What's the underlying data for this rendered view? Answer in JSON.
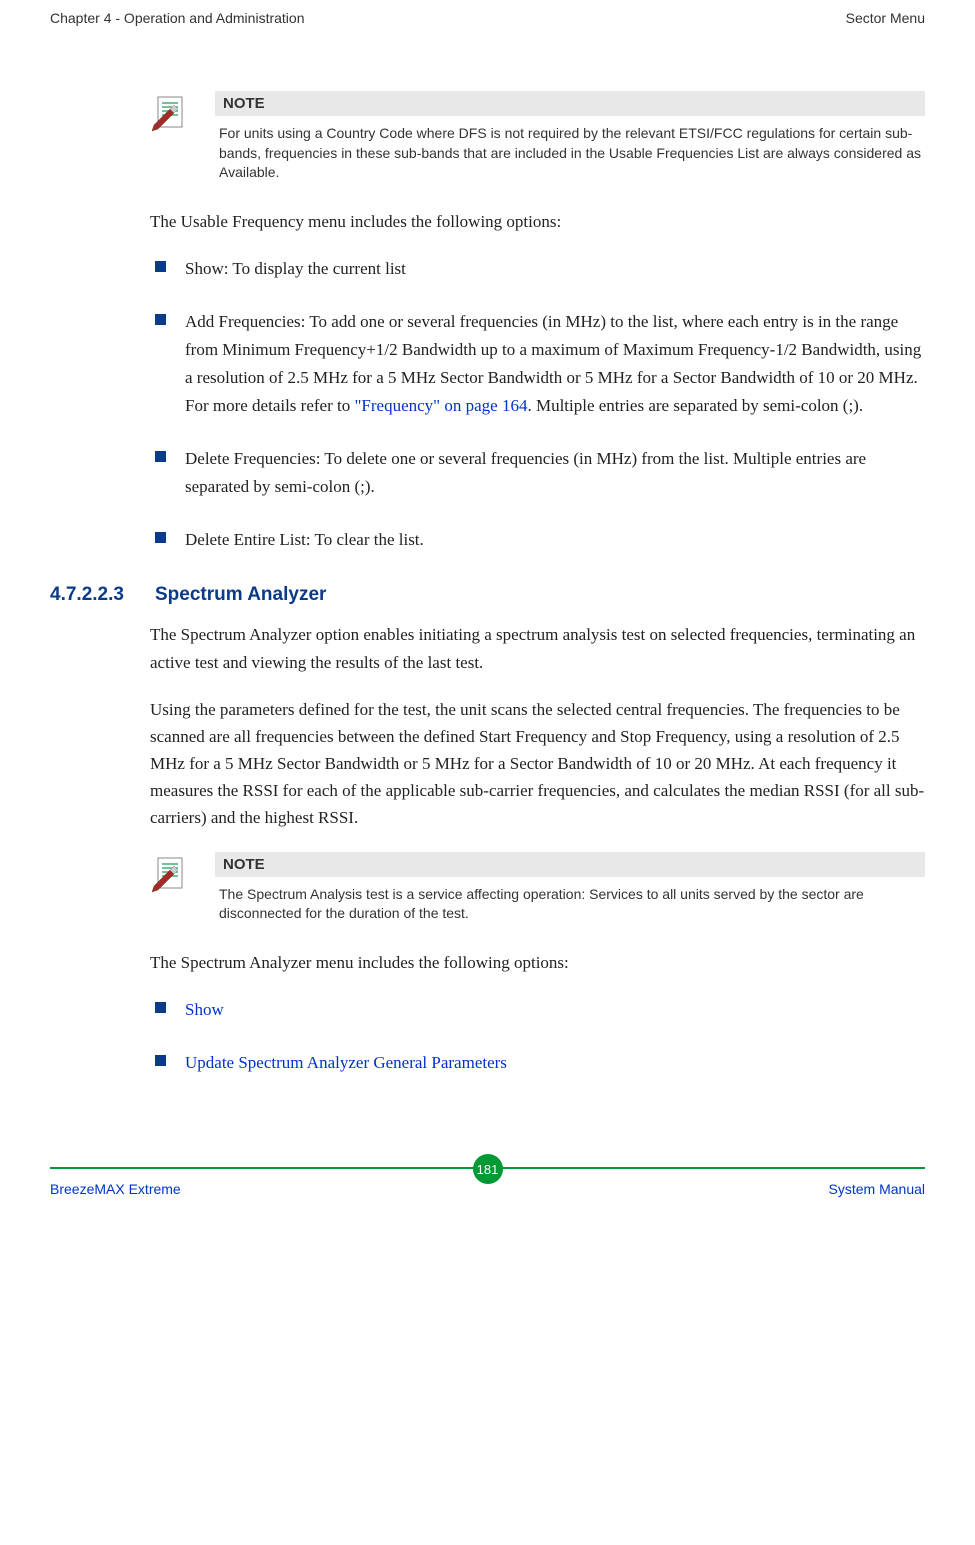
{
  "header": {
    "left": "Chapter 4 - Operation and Administration",
    "right": "Sector Menu"
  },
  "note1": {
    "label": "NOTE",
    "text": "For units using a Country Code where DFS is not required by the relevant ETSI/FCC regulations for certain sub-bands, frequencies in these sub-bands that are included in the Usable Frequencies List are always considered as Available."
  },
  "para1": "The Usable Frequency menu includes the following options:",
  "bullets1": {
    "b1": "Show: To display the current list",
    "b2_pre": "Add Frequencies: To add one or several frequencies (in MHz) to the list, where each entry is in the range from Minimum Frequency+1/2 Bandwidth up to a maximum of Maximum Frequency-1/2 Bandwidth, using a resolution of 2.5 MHz for a 5 MHz Sector Bandwidth or 5 MHz for a Sector Bandwidth of 10 or 20 MHz. For more details refer to ",
    "b2_link": "\"Frequency\" on page 164",
    "b2_post": ". Multiple entries are separated by semi-colon (;).",
    "b3": "Delete Frequencies: To delete one or several frequencies (in MHz) from the list. Multiple entries are separated by semi-colon (;).",
    "b4": "Delete Entire List: To clear the list."
  },
  "section": {
    "num": "4.7.2.2.3",
    "title": "Spectrum Analyzer"
  },
  "para2": "The Spectrum Analyzer option enables initiating a spectrum analysis test on selected frequencies, terminating an active test and viewing the results of the last test.",
  "para3": "Using the parameters defined for the test, the unit scans the selected central frequencies. The frequencies to be scanned are all frequencies between the defined Start Frequency and Stop Frequency, using a resolution of 2.5 MHz for a 5 MHz Sector Bandwidth or 5 MHz for a Sector Bandwidth of 10 or 20 MHz. At each frequency it measures the RSSI for each of the applicable sub-carrier frequencies, and calculates the median RSSI (for all sub-carriers) and the highest RSSI.",
  "note2": {
    "label": "NOTE",
    "text": "The Spectrum Analysis test is a service affecting operation: Services to all units served by the sector are disconnected for the duration of the test."
  },
  "para4": "The Spectrum Analyzer menu includes the following options:",
  "bullets2": {
    "b1": "Show",
    "b2": "Update Spectrum Analyzer General Parameters"
  },
  "footer": {
    "left": "BreezeMAX Extreme",
    "page": "181",
    "right": "System Manual"
  }
}
